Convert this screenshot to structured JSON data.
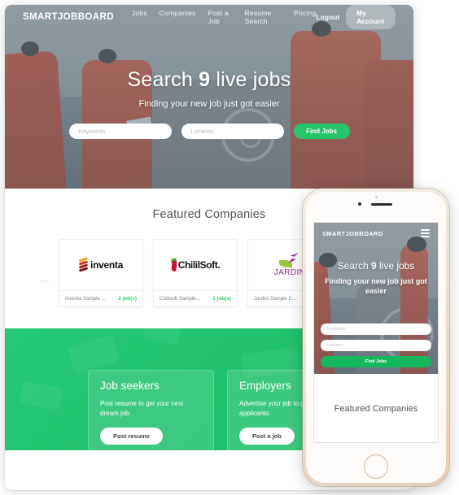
{
  "desktop": {
    "header": {
      "brand": "SMARTJOBBOARD",
      "nav": [
        {
          "label": "Jobs"
        },
        {
          "label": "Companies"
        },
        {
          "label": "Post a Job"
        },
        {
          "label": "Resume Search"
        },
        {
          "label": "Pricing"
        }
      ],
      "logout_label": "Logout",
      "account_label": "My Account"
    },
    "hero": {
      "title_prefix": "Search ",
      "title_count": "9",
      "title_suffix": " live jobs",
      "subtitle": "Finding your new job just got easier",
      "keywords_placeholder": "Keywords",
      "keywords_value": "",
      "location_placeholder": "Location",
      "location_value": "",
      "find_label": "Find Jobs"
    },
    "featured": {
      "title": "Featured Companies",
      "prev_arrow": "←",
      "companies": [
        {
          "logo_text": "inventa",
          "name": "Inventa Sample ...",
          "jobs": "2 job(s)"
        },
        {
          "logo_text": "ChililSoft.",
          "name": "Chilisoft Sample...",
          "jobs": "1 job(s)"
        },
        {
          "logo_text": "JARDIN",
          "name": "Jardini Sample E...",
          "jobs": ""
        }
      ]
    },
    "cta": {
      "cards": [
        {
          "heading": "Job seekers",
          "text": "Post resume to get your next dream job.",
          "button": "Post resume"
        },
        {
          "heading": "Employers",
          "text": "Advertise your job to get qualified applicants.",
          "button": "Post a job"
        }
      ]
    }
  },
  "phone": {
    "brand": "SMARTJOBBOARD",
    "title_prefix": "Search ",
    "title_count": "9",
    "title_suffix": " live jobs",
    "subtitle": "Finding your new job just got easier",
    "keywords_placeholder": "Keywords",
    "location_placeholder": "Location",
    "find_label": "Find Jobs",
    "featured_title": "Featured Companies"
  },
  "colors": {
    "green_primary": "#28c46c",
    "green_band": "#21c16f",
    "green_accent": "#2ecc71",
    "text_dark": "#4e5356"
  }
}
